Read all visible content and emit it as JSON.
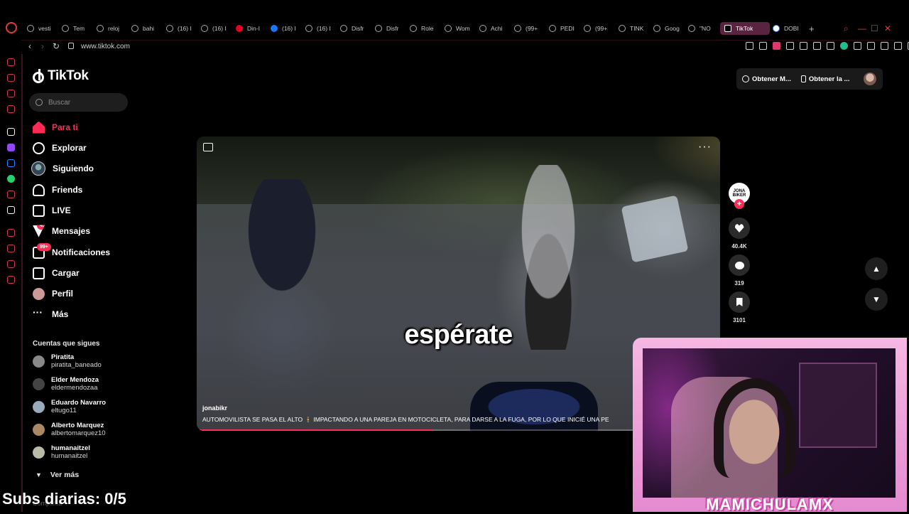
{
  "browser": {
    "tabs": [
      {
        "label": "vesti",
        "icon": "globe-icon"
      },
      {
        "label": "Tem",
        "icon": "globe-icon"
      },
      {
        "label": "reloj",
        "icon": "globe-icon"
      },
      {
        "label": "bahi",
        "icon": "globe-icon"
      },
      {
        "label": "(16) I",
        "icon": "globe-icon"
      },
      {
        "label": "(16) I",
        "icon": "globe-icon"
      },
      {
        "label": "Din-I",
        "icon": "pinterest-icon"
      },
      {
        "label": "(16) I",
        "icon": "facebook-icon"
      },
      {
        "label": "(16) I",
        "icon": "globe-icon"
      },
      {
        "label": "Disfr",
        "icon": "globe-icon"
      },
      {
        "label": "Disfr",
        "icon": "globe-icon"
      },
      {
        "label": "Role",
        "icon": "globe-icon"
      },
      {
        "label": "Wom",
        "icon": "globe-icon"
      },
      {
        "label": "Achi",
        "icon": "globe-icon"
      },
      {
        "label": "(99+",
        "icon": "globe-icon"
      },
      {
        "label": "PEDI",
        "icon": "globe-icon"
      },
      {
        "label": "(99+",
        "icon": "globe-icon"
      },
      {
        "label": "TINK",
        "icon": "globe-icon"
      },
      {
        "label": "Goog",
        "icon": "globe-icon"
      },
      {
        "label": "\"NO",
        "icon": "globe-icon"
      }
    ],
    "active_tab": {
      "label": "TikTok"
    },
    "after_tab": {
      "label": "DOBI"
    },
    "new_tab": "+",
    "url": "www.tiktok.com"
  },
  "sidebar": {
    "logo": "TikTok",
    "search_placeholder": "Buscar",
    "items": [
      {
        "label": "Para ti",
        "icon": "home-icon",
        "active": true
      },
      {
        "label": "Explorar",
        "icon": "compass-icon"
      },
      {
        "label": "Siguiendo",
        "icon": "following-avatar-icon"
      },
      {
        "label": "Friends",
        "icon": "friends-icon"
      },
      {
        "label": "LIVE",
        "icon": "live-icon"
      },
      {
        "label": "Mensajes",
        "icon": "messages-icon",
        "badge": "45"
      },
      {
        "label": "Notificaciones",
        "icon": "notifications-icon",
        "badge": "99+"
      },
      {
        "label": "Cargar",
        "icon": "upload-icon"
      },
      {
        "label": "Perfil",
        "icon": "profile-icon"
      },
      {
        "label": "Más",
        "icon": "more-icon"
      }
    ],
    "following_title": "Cuentas que sigues",
    "accounts": [
      {
        "name": "Piratita",
        "handle": "piratita_baneado"
      },
      {
        "name": "Elder Mendoza",
        "handle": "eldermendozaa"
      },
      {
        "name": "Eduardo Navarro",
        "handle": "eltugo11"
      },
      {
        "name": "Alberto Marquez",
        "handle": "albertomarquez10"
      },
      {
        "name": "humanaitzel",
        "handle": "humanaitzel"
      }
    ],
    "see_more": "Ver más",
    "footer": "Compañía"
  },
  "top_actions": {
    "get_coins": "Obtener M...",
    "get_app": "Obtener la ..."
  },
  "video": {
    "caption": "espérate",
    "author": "jonabikr",
    "description": "AUTOMOVILISTA SE PASA EL ALTO 🚦 IMPACTANDO A UNA PAREJA EN MOTOCICLETA, PARA DARSE A LA FUGA, POR LO QUE INICIÉ UNA PE",
    "progress": 0.45,
    "creator_badge": "JONA BIKER",
    "likes": "40.4K",
    "comments": "319",
    "saves": "3101"
  },
  "overlay": {
    "streamer_name": "MAMICHULAMX",
    "subs_counter": "Subs diarias: 0/5"
  },
  "colors": {
    "accent": "#fe2c55",
    "overlay_pink": "#f6b7e3",
    "opera_red": "#e23b3b"
  }
}
